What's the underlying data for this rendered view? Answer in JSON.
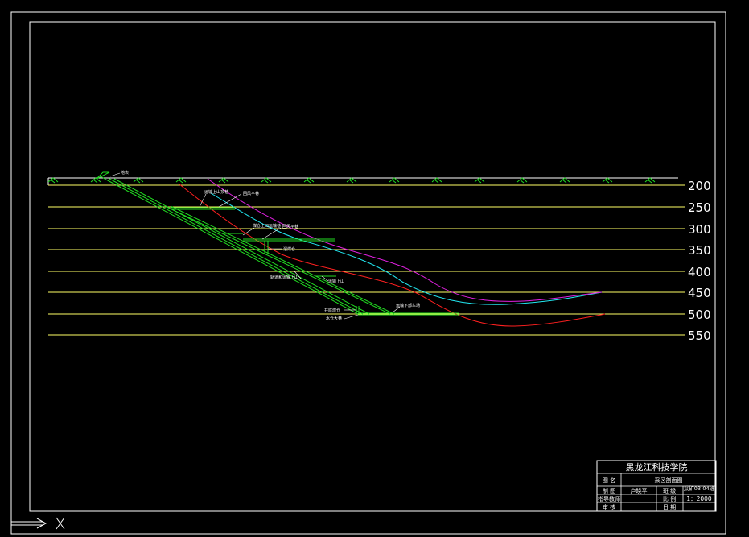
{
  "colors": {
    "background": "#000000",
    "frame": "#ffffff",
    "level_line": "#ffff66",
    "seam": "#22dd22",
    "curve_red": "#ff2020",
    "curve_cyan": "#22e6f0",
    "curve_magenta": "#e020e0",
    "surface_symbol": "#22dd22"
  },
  "level_labels": [
    "200",
    "250",
    "300",
    "350",
    "400",
    "450",
    "500",
    "550"
  ],
  "drawing_labels": {
    "surface": "地表",
    "upper_coal_roadway": "运输上山顶巷",
    "return_roadway": "回风平巷",
    "coal_bunker_top": "煤仓上口运输巷",
    "bunker_return": "回风平巷",
    "coal_bunker": "溜煤仓",
    "track_incline": "轨道和运输上山",
    "belt_incline": "运输上山",
    "lower_coal_roadway": "运输下部车场",
    "shaft_bottom": "井底煤仓",
    "water_sump": "水仓大巷"
  },
  "title_block": {
    "institution": "黑龙江科技学院",
    "row1_label": "图 名",
    "row1_value": "采区剖面图",
    "row2_label": "制 图",
    "row2_name": "卢晓平",
    "row2_field": "班 级",
    "row2_value": "采矿03-04班",
    "row3_label": "指导教师",
    "row3_field": "比 例",
    "row3_value": "1：2000",
    "row4_label": "审 核",
    "row4_field": "日 期"
  }
}
